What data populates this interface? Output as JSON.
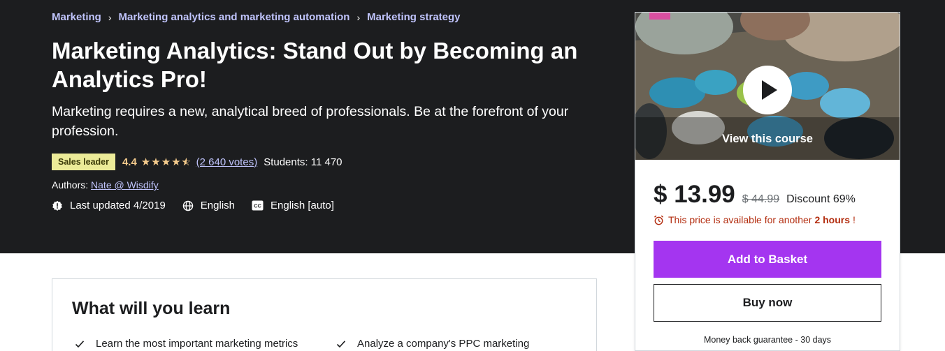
{
  "breadcrumb": {
    "items": [
      "Marketing",
      "Marketing analytics and marketing automation",
      "Marketing strategy"
    ],
    "separator": "›"
  },
  "course": {
    "title": "Marketing Analytics: Stand Out by Becoming an Analytics Pro!",
    "subtitle": "Marketing requires a new, analytical breed of professionals. Be at the forefront of your profession.",
    "badge": "Sales leader",
    "rating": "4.4",
    "rating_stars": 4.5,
    "votes": "(2 640 votes)",
    "students": "Students: 11 470",
    "authors_label": "Authors:",
    "author": "Nate @ Wisdify",
    "last_updated": "Last updated 4/2019",
    "language": "English",
    "captions": "English [auto]"
  },
  "sidebar": {
    "preview_label": "View this course",
    "price": "$ 13.99",
    "old_price": "$ 44.99",
    "discount": "Discount 69%",
    "timer_prefix": "This price is available for another",
    "timer_hours": "2 hours",
    "timer_suffix": "!",
    "add_to_basket": "Add to Basket",
    "buy_now": "Buy now",
    "guarantee": "Money back guarantee - 30 days"
  },
  "learn": {
    "title": "What will you learn",
    "items": [
      "Learn the most important marketing metrics",
      "Analyze a company's PPC marketing"
    ]
  },
  "colors": {
    "hero_bg": "#1c1d1f",
    "link": "#c0c4fc",
    "star": "#f3ca8c",
    "badge_bg": "#eceb98",
    "accent_purple": "#a435f0",
    "timer_red": "#b32d0f"
  },
  "icons": {
    "breadcrumb_separator": "chevron-right-icon",
    "star": "star-icon",
    "last_updated": "alert-badge-icon",
    "language": "globe-icon",
    "captions": "closed-captions-icon",
    "play": "play-icon",
    "timer": "alarm-clock-icon",
    "learn_item": "check-icon"
  }
}
